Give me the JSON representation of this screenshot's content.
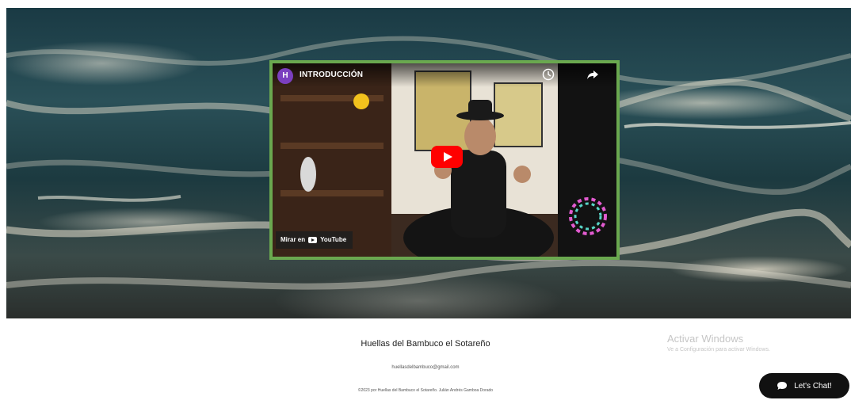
{
  "video": {
    "channel_initial": "H",
    "title": "INTRODUCCIÓN",
    "watch_on": "Mirar en",
    "youtube": "YouTube"
  },
  "footer": {
    "site_name": "Huellas del Bambuco el Sotareño",
    "email": "huellasdelbambuco@gmail.com",
    "copyright": "©2023 por Huellas del Bambuco el Sotareño. Julián Andrés Gamboa Dorado"
  },
  "os_watermark": {
    "line1": "Activar Windows",
    "line2": "Ve a Configuración para activar Windows."
  },
  "chat": {
    "label": "Let's Chat!"
  },
  "colors": {
    "video_border": "#6aa84f",
    "play_button": "#ff0000",
    "chat_bg": "#111111",
    "channel_avatar": "#7b3fbf"
  }
}
